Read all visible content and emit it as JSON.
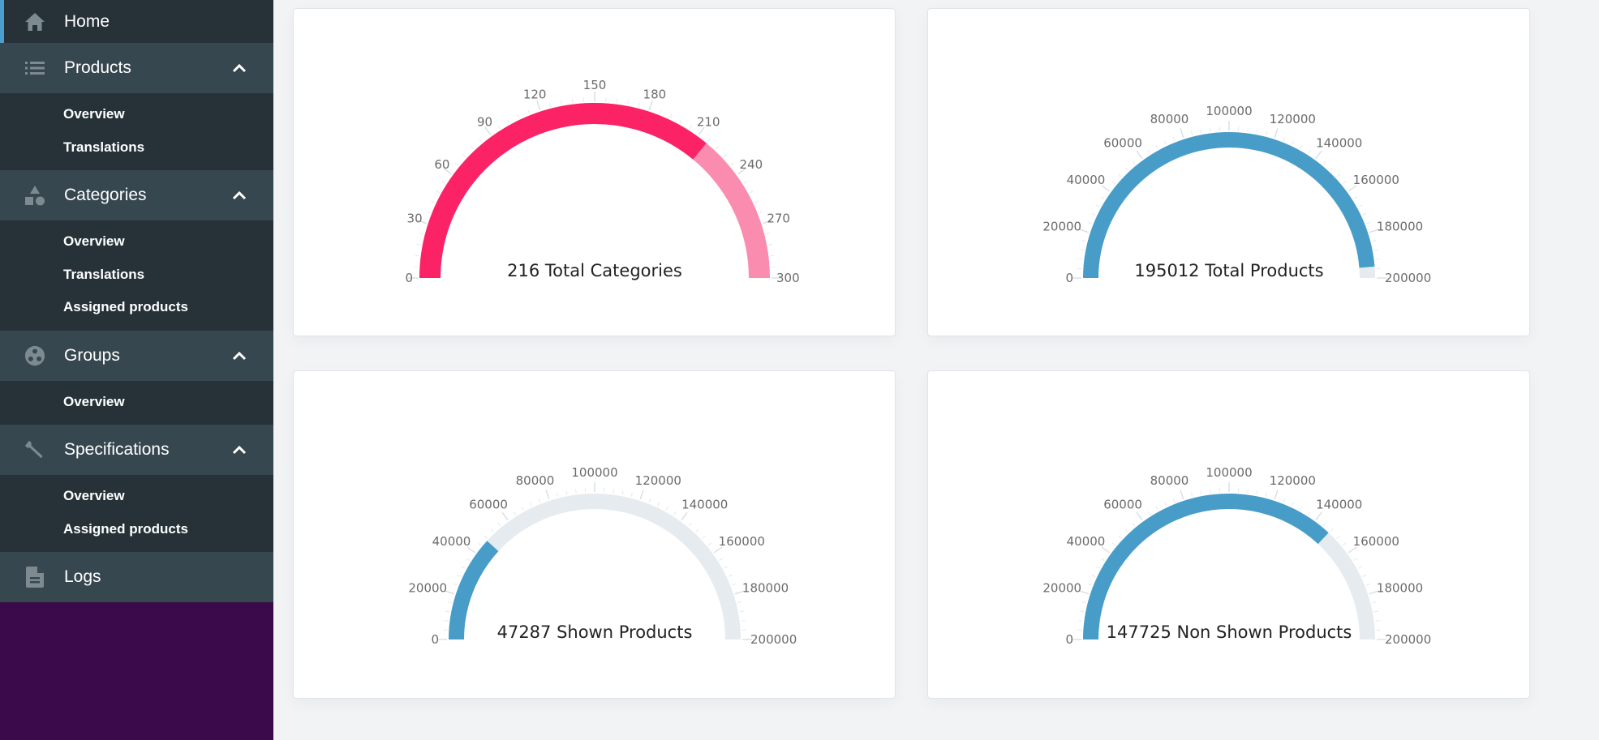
{
  "sidebar": {
    "home": {
      "label": "Home",
      "icon": "home-icon",
      "active": true
    },
    "groups": [
      {
        "label": "Products",
        "icon": "list-icon",
        "expanded": true,
        "items": [
          "Overview",
          "Translations"
        ]
      },
      {
        "label": "Categories",
        "icon": "shapes-icon",
        "expanded": true,
        "items": [
          "Overview",
          "Translations",
          "Assigned products"
        ]
      },
      {
        "label": "Groups",
        "icon": "group-icon",
        "expanded": true,
        "items": [
          "Overview"
        ]
      },
      {
        "label": "Specifications",
        "icon": "wrench-icon",
        "expanded": true,
        "items": [
          "Overview",
          "Assigned products"
        ]
      }
    ],
    "logs": {
      "label": "Logs",
      "icon": "document-icon"
    }
  },
  "colors": {
    "sidebar_bg": "#263238",
    "sidebar_group_bg": "#37474f",
    "sidebar_filler": "#3a0a4a",
    "active_indicator": "#4a9fd0",
    "categories_fill": "#fc2266",
    "categories_track": "#fa8cb0",
    "products_fill": "#489dc8",
    "products_track": "#e6ebef"
  },
  "chart_data": [
    {
      "type": "gauge",
      "title": "216 Total Categories",
      "value": 216,
      "min": 0,
      "max": 300,
      "major_ticks": [
        0,
        30,
        60,
        90,
        120,
        150,
        180,
        210,
        240,
        270,
        300
      ],
      "fill_color": "#fc2266",
      "track_color": "#fa8cb0"
    },
    {
      "type": "gauge",
      "title": "195012 Total Products",
      "value": 195012,
      "min": 0,
      "max": 200000,
      "major_ticks": [
        0,
        20000,
        40000,
        60000,
        80000,
        100000,
        120000,
        140000,
        160000,
        180000,
        200000
      ],
      "fill_color": "#489dc8",
      "track_color": "#e6ebef"
    },
    {
      "type": "gauge",
      "title": "47287 Shown Products",
      "value": 47287,
      "min": 0,
      "max": 200000,
      "major_ticks": [
        0,
        20000,
        40000,
        60000,
        80000,
        100000,
        120000,
        140000,
        160000,
        180000,
        200000
      ],
      "fill_color": "#489dc8",
      "track_color": "#e6ebef"
    },
    {
      "type": "gauge",
      "title": "147725 Non Shown Products",
      "value": 147725,
      "min": 0,
      "max": 200000,
      "major_ticks": [
        0,
        20000,
        40000,
        60000,
        80000,
        100000,
        120000,
        140000,
        160000,
        180000,
        200000
      ],
      "fill_color": "#489dc8",
      "track_color": "#e6ebef"
    }
  ]
}
